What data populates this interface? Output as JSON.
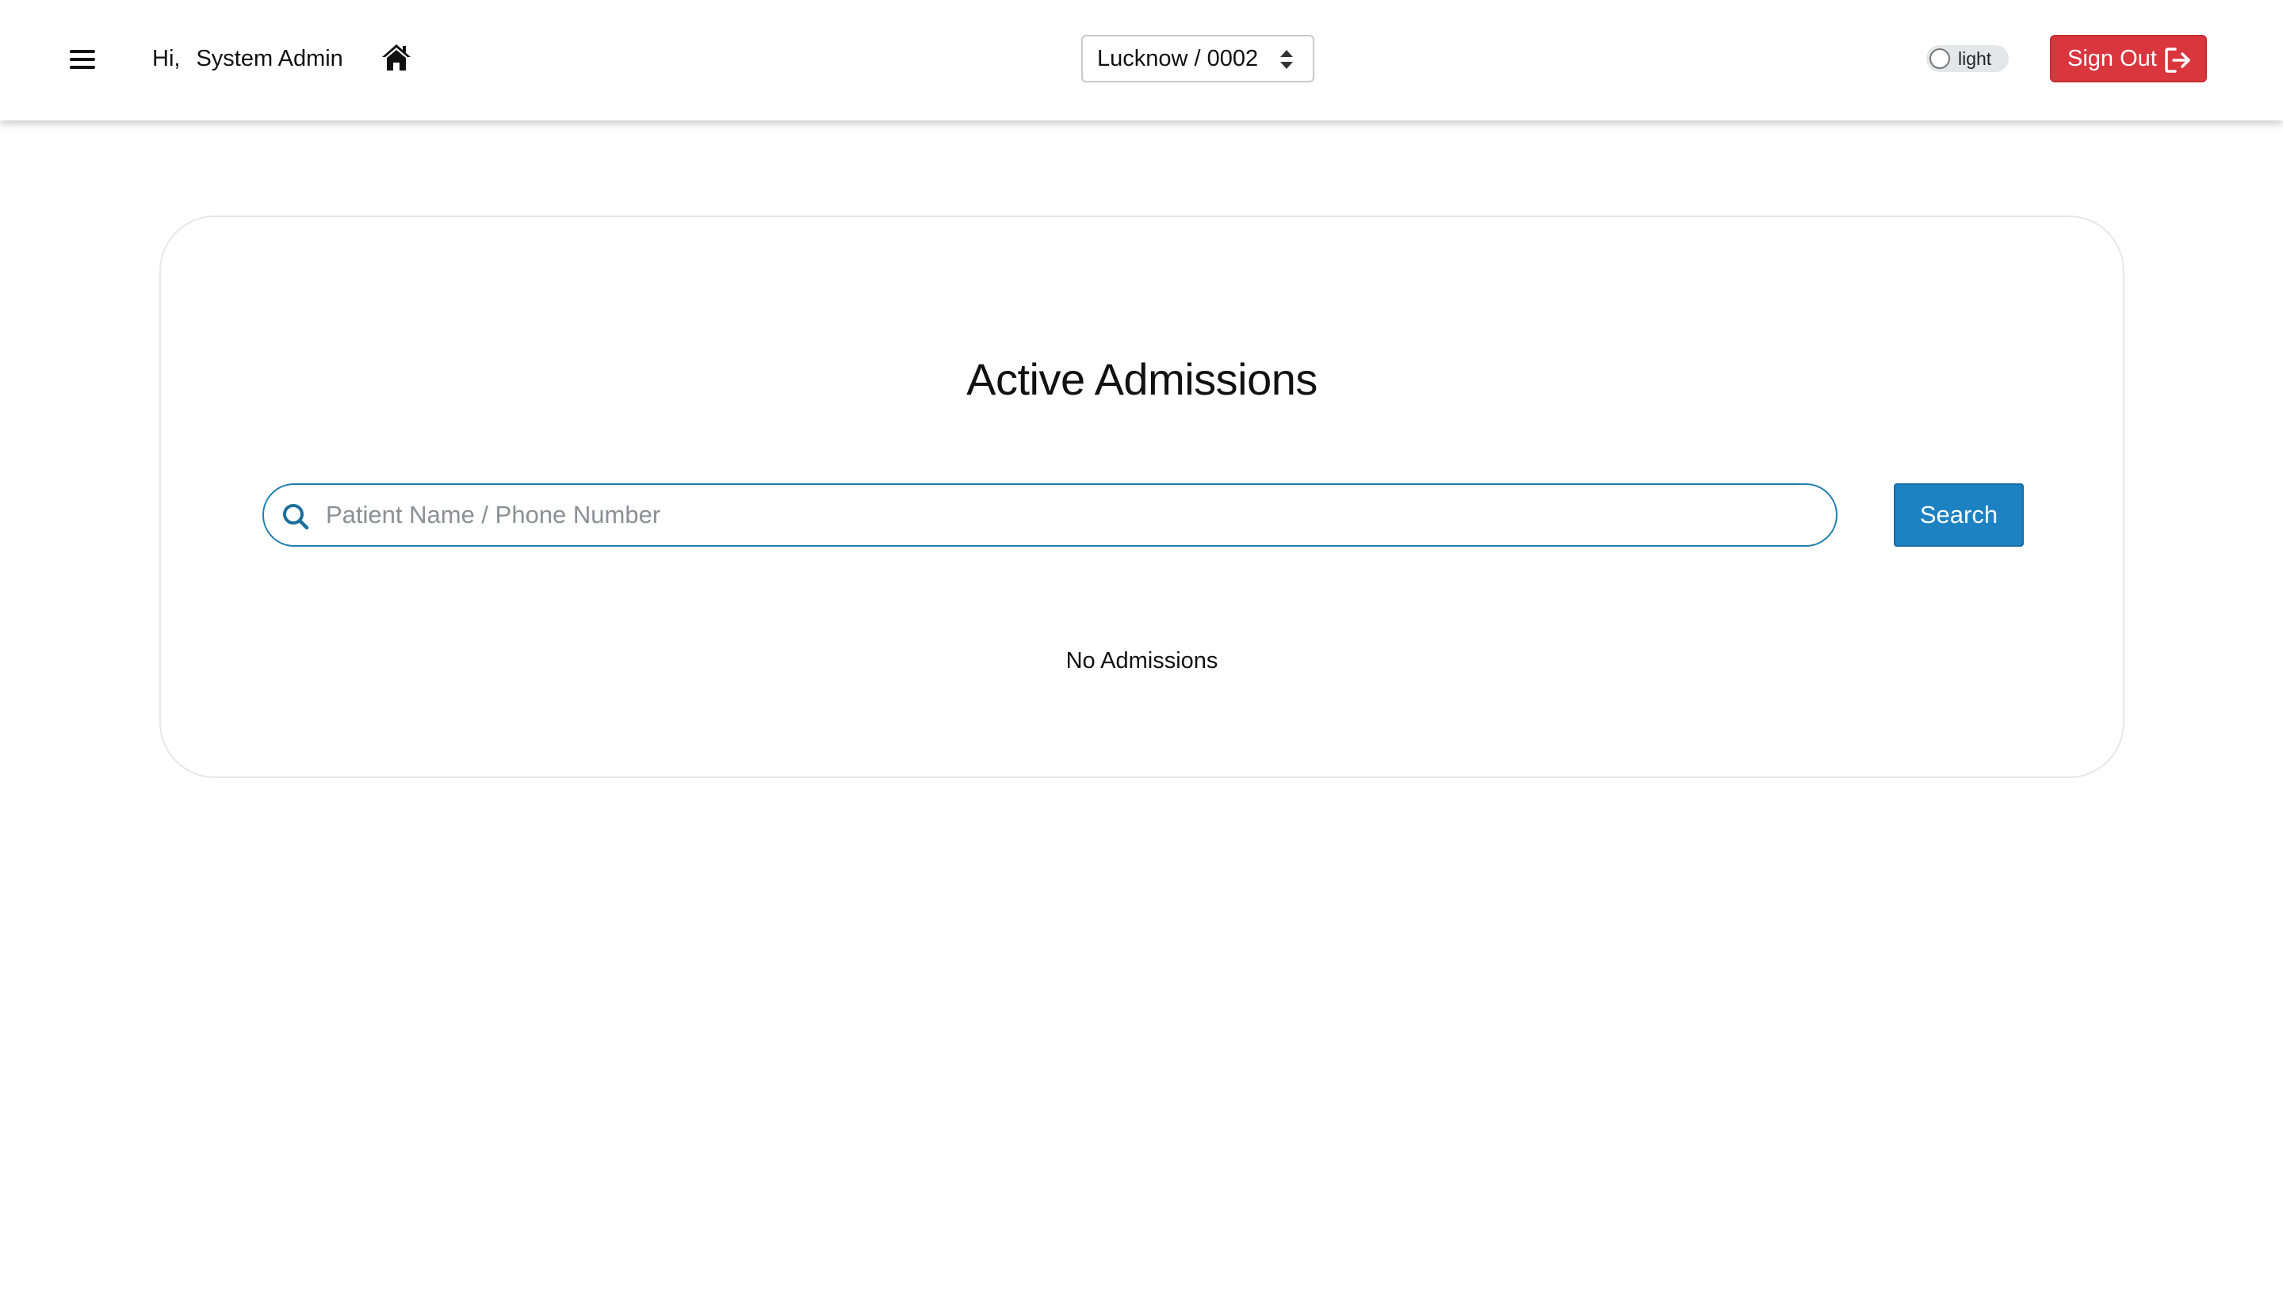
{
  "header": {
    "greeting_prefix": "Hi,",
    "user_name": "System Admin",
    "location_select_value": "Lucknow / 0002",
    "theme_toggle_label": "light",
    "sign_out_label": "Sign Out",
    "icons": {
      "menu": "hamburger-menu-icon",
      "home": "home-icon",
      "select": "select-updown-arrows-icon",
      "sign_out": "sign-out-icon"
    }
  },
  "main": {
    "title": "Active Admissions",
    "search": {
      "placeholder": "Patient Name / Phone Number",
      "value": "",
      "icon": "search-icon",
      "button_label": "Search"
    },
    "empty_message": "No Admissions"
  },
  "colors": {
    "primary_blue": "#1d82c2",
    "danger_red": "#d9363e",
    "search_border": "#1d7fb0"
  }
}
